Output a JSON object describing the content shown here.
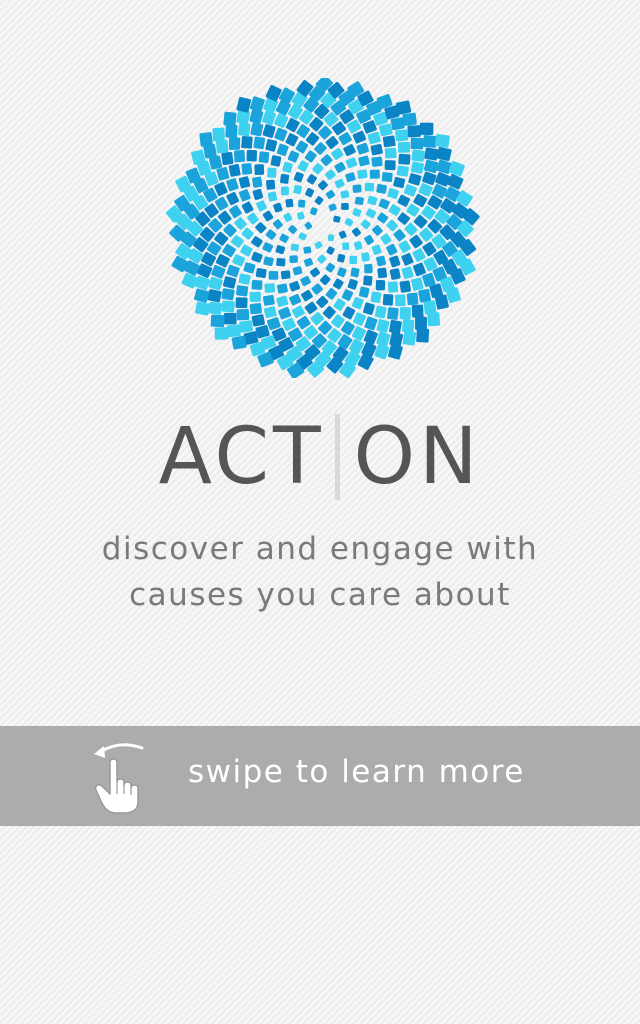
{
  "brand": {
    "name_part1": "ACT",
    "name_part2": "ON",
    "logo_icon": "mosaic-flower-icon",
    "colors": {
      "light_cyan": "#3fd1f0",
      "mid_blue": "#1ba3db",
      "deep_blue": "#0b84c6",
      "text_gray": "#555555",
      "tagline_gray": "#7a7a7a",
      "band_gray": "#acacac"
    }
  },
  "tagline": {
    "line1": "discover and engage with",
    "line2": "causes you care about"
  },
  "swipe": {
    "label": "swipe to learn more",
    "icon": "swipe-hand-icon"
  }
}
